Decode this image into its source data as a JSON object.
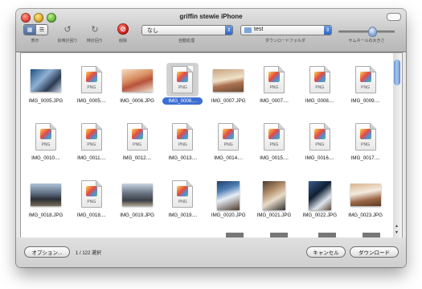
{
  "window": {
    "title": "griffin stewie iPhone"
  },
  "toolbar": {
    "view_label": "表示",
    "rotate_left_label": "反時計回り",
    "rotate_right_label": "時計回り",
    "delete_label": "削除",
    "auto_action_label": "自動処理",
    "auto_action_value": "なし",
    "download_folder_label": "ダウンロードフォルダ",
    "download_folder_value": "test",
    "thumb_size_label": "サムネールの大きさ",
    "thumb_size_level": 0.6
  },
  "items": [
    {
      "name": "IMG_0005.JPG",
      "type": "photo"
    },
    {
      "name": "IMG_0005....",
      "type": "file"
    },
    {
      "name": "IMG_0006.JPG",
      "type": "photo"
    },
    {
      "name": "IMG_0006....",
      "type": "file",
      "selected": true
    },
    {
      "name": "IMG_0007.JPG",
      "type": "photo"
    },
    {
      "name": "IMG_0007....",
      "type": "file"
    },
    {
      "name": "IMG_0008....",
      "type": "file"
    },
    {
      "name": "IMG_0009....",
      "type": "file"
    },
    {
      "name": "IMG_0010....",
      "type": "file"
    },
    {
      "name": "IMG_0011....",
      "type": "file"
    },
    {
      "name": "IMG_0012....",
      "type": "file"
    },
    {
      "name": "IMG_0013....",
      "type": "file"
    },
    {
      "name": "IMG_0014....",
      "type": "file"
    },
    {
      "name": "IMG_0015....",
      "type": "file"
    },
    {
      "name": "IMG_0016....",
      "type": "file"
    },
    {
      "name": "IMG_0017....",
      "type": "file"
    },
    {
      "name": "IMG_0018.JPG",
      "type": "photo"
    },
    {
      "name": "IMG_0018....",
      "type": "file"
    },
    {
      "name": "IMG_0019.JPG",
      "type": "photo"
    },
    {
      "name": "IMG_0019....",
      "type": "file"
    },
    {
      "name": "IMG_0020.JPG",
      "type": "photo"
    },
    {
      "name": "IMG_0021.JPG",
      "type": "photo"
    },
    {
      "name": "IMG_0022.JPG",
      "type": "photo"
    },
    {
      "name": "IMG_0023.JPG",
      "type": "photo"
    }
  ],
  "file_ext": "PNG",
  "footer": {
    "options_label": "オプション...",
    "selection_count": "1 / 122 選択",
    "cancel_label": "キャンセル",
    "download_label": "ダウンロード"
  }
}
